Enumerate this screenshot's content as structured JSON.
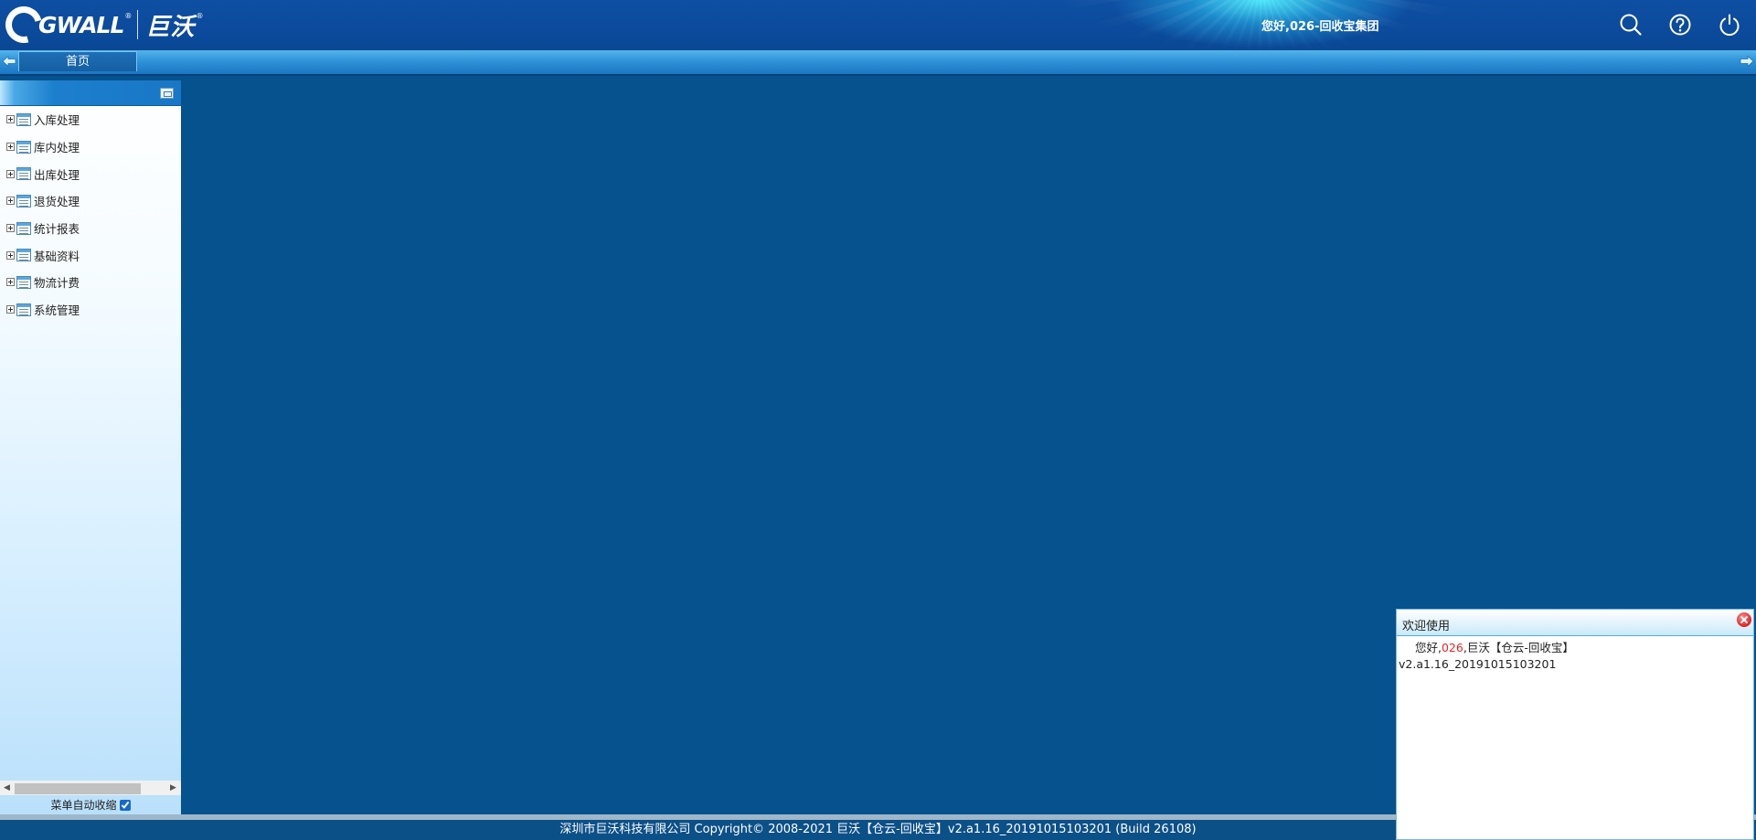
{
  "header": {
    "logo_text": "GWALL",
    "logo_cn": "巨沃",
    "greeting": "您好,026-回收宝集团",
    "icons": [
      "search-icon",
      "help-icon",
      "power-icon"
    ]
  },
  "tabs": [
    {
      "label": "首页"
    }
  ],
  "menu": {
    "items": [
      {
        "label": "入库处理"
      },
      {
        "label": "库内处理"
      },
      {
        "label": "出库处理"
      },
      {
        "label": "退货处理"
      },
      {
        "label": "统计报表"
      },
      {
        "label": "基础资料"
      },
      {
        "label": "物流计费"
      },
      {
        "label": "系统管理"
      }
    ],
    "auto_collapse_label": "菜单自动收缩",
    "auto_collapse_checked": true
  },
  "footer": {
    "text": "深圳市巨沃科技有限公司 Copyright© 2008-2021 巨沃【仓云-回收宝】v2.a1.16_20191015103201 (Build 26108)"
  },
  "welcome": {
    "title": "欢迎使用",
    "greeting_prefix": "您好,",
    "user_code": "026",
    "greeting_suffix": ",巨沃【仓云-回收宝】",
    "version": "v2.a1.16_20191015103201"
  },
  "colors": {
    "background": "#06528e",
    "highlight": "#e2262b"
  }
}
